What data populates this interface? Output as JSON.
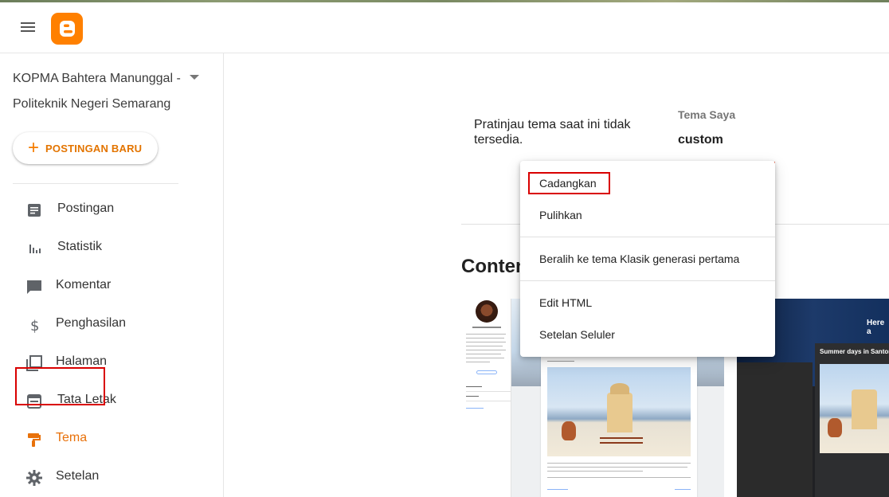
{
  "app": {
    "logo_icon": "blogger-logo-icon",
    "brand_color": "#ff8000"
  },
  "sidebar": {
    "blog_name": "KOPMA Bahtera Manunggal - Politeknik Negeri Semarang",
    "new_post_label": "POSTINGAN BARU",
    "items": [
      {
        "label": "Postingan",
        "icon": "posts-icon"
      },
      {
        "label": "Statistik",
        "icon": "stats-icon"
      },
      {
        "label": "Komentar",
        "icon": "comment-icon"
      },
      {
        "label": "Penghasilan",
        "icon": "dollar-icon"
      },
      {
        "label": "Halaman",
        "icon": "pages-icon"
      },
      {
        "label": "Tata Letak",
        "icon": "layout-icon"
      },
      {
        "label": "Tema",
        "icon": "theme-paint-roller-icon",
        "active": true
      },
      {
        "label": "Setelan",
        "icon": "gear-icon"
      }
    ],
    "active_color": "#e8710a",
    "highlight_color": "#d90000"
  },
  "main": {
    "preview_unavailable": "Pratinjau tema saat ini tidak tersedia.",
    "my_theme_label": "Tema Saya",
    "my_theme_name": "custom",
    "section_heading": "Conten",
    "thumbs": [
      {
        "post_title": ""
      },
      {
        "post_title": "Summer days in Santorini",
        "hero_text": "Here a"
      }
    ]
  },
  "menu": {
    "items": [
      "Cadangkan",
      "Pulihkan",
      "Beralih ke tema Klasik generasi pertama",
      "Edit HTML",
      "Setelan Seluler"
    ]
  }
}
